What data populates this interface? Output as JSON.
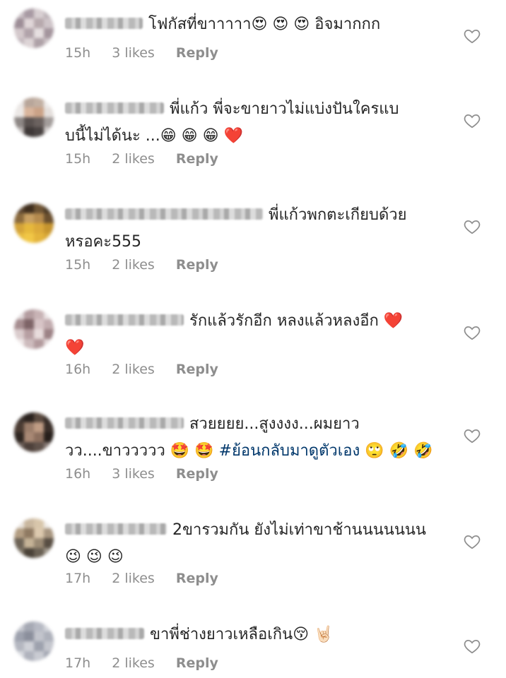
{
  "comments": [
    {
      "text_lines": [
        "โฟกัสที่ขาาาาา",
        "😍 😍 😍",
        "อิจมากกก"
      ],
      "lines": [
        [
          "โฟกัสที่ขาาาาา😍 😍 😍  อิจมากกก"
        ]
      ],
      "time": "15h",
      "likes": "3 likes",
      "reply": "Reply"
    },
    {
      "lines": [
        [
          "พี่แก้ว พี่จะขายาวไม่แบ่งปันใครแบ"
        ],
        [
          "บนี้ไม่ได้นะ ...😁 😁 😁 ❤️"
        ]
      ],
      "time": "15h",
      "likes": "2 likes",
      "reply": "Reply"
    },
    {
      "lines": [
        [
          "พี่แก้วพกตะเกียบด้วย"
        ],
        [
          "หรอคะ555"
        ]
      ],
      "time": "15h",
      "likes": "2 likes",
      "reply": "Reply"
    },
    {
      "lines": [
        [
          "รักแล้วรักอีก หลงแล้วหลงอีก ❤️"
        ],
        [
          "❤️"
        ]
      ],
      "time": "16h",
      "likes": "2 likes",
      "reply": "Reply"
    },
    {
      "lines": [
        [
          "สวยยยย...สูงงงง...ผมยาว"
        ],
        [
          "วว....ขาววววว 🤩 🤩 ",
          "#ย้อนกลับมาดูตัวเอง",
          " 🙄 🤣 🤣"
        ]
      ],
      "time": "16h",
      "likes": "3 likes",
      "reply": "Reply"
    },
    {
      "lines": [
        [
          "2ขารวมกัน ยังไม่เท่าขาช้านนนนนนน"
        ],
        [
          "😉 😉 😉"
        ]
      ],
      "time": "17h",
      "likes": "2 likes",
      "reply": "Reply"
    },
    {
      "lines": [
        [
          "ขาพี่ช่างยาวเหลือเกิน😚 🤘🏻"
        ]
      ],
      "time": "17h",
      "likes": "2 likes",
      "reply": "Reply"
    }
  ],
  "colors": {
    "text": "#262626",
    "meta": "#8e8e8e",
    "hashtag": "#00376b",
    "heart_outline": "#8e8e8e"
  },
  "icons": {
    "like": "heart-outline-icon",
    "avatar": "blurred-avatar"
  }
}
